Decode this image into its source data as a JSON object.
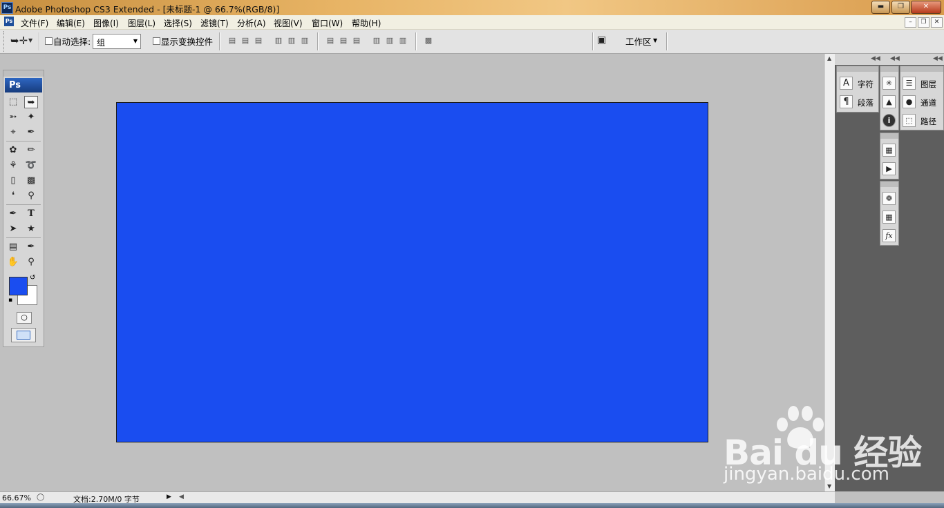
{
  "window": {
    "title": "Adobe Photoshop CS3 Extended - [未标题-1 @ 66.7%(RGB/8)]",
    "app_icon": "Ps"
  },
  "menu": {
    "items": [
      "文件(F)",
      "编辑(E)",
      "图像(I)",
      "图层(L)",
      "选择(S)",
      "滤镜(T)",
      "分析(A)",
      "视图(V)",
      "窗口(W)",
      "帮助(H)"
    ]
  },
  "options": {
    "auto_select_label": "自动选择:",
    "auto_select_value": "组",
    "show_transform_label": "显示变换控件",
    "workspace_label": "工作区"
  },
  "toolbox": {
    "header": "Ps"
  },
  "colors": {
    "foreground": "#1a4df0",
    "background": "#ffffff",
    "document_fill": "#1a4df0"
  },
  "panels": {
    "group1": [
      {
        "icon": "character-icon",
        "glyph": "A",
        "label": "字符"
      },
      {
        "icon": "paragraph-icon",
        "glyph": "¶",
        "label": "段落"
      }
    ],
    "group3": [
      {
        "icon": "layers-icon",
        "label": "图层"
      },
      {
        "icon": "channels-icon",
        "label": "通道"
      },
      {
        "icon": "paths-icon",
        "label": "路径"
      }
    ]
  },
  "status": {
    "zoom": "66.67%",
    "doc_info": "文档:2.70M/0 字节"
  },
  "watermark": {
    "brand": "Bai du 经验",
    "url": "jingyan.baidu.com"
  }
}
